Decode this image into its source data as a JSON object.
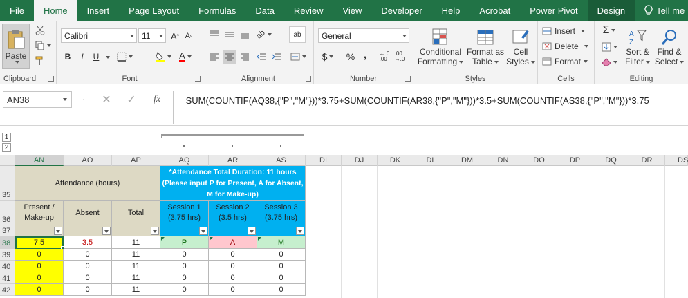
{
  "tabs": [
    "File",
    "Home",
    "Insert",
    "Page Layout",
    "Formulas",
    "Data",
    "Review",
    "View",
    "Developer",
    "Help",
    "Acrobat",
    "Power Pivot",
    "Design",
    "Tell me"
  ],
  "ribbon": {
    "clipboard": {
      "label": "Clipboard",
      "paste": "Paste"
    },
    "font": {
      "label": "Font",
      "name": "Calibri",
      "size": "11",
      "bold": "B",
      "italic": "I",
      "underline": "U"
    },
    "alignment": {
      "label": "Alignment"
    },
    "number": {
      "label": "Number",
      "format": "General",
      "currency": "$",
      "percent": "%",
      "comma": ","
    },
    "styles": {
      "label": "Styles",
      "cond1": "Conditional",
      "cond2": "Formatting",
      "fmt1": "Format as",
      "fmt2": "Table",
      "cell1": "Cell",
      "cell2": "Styles"
    },
    "cells": {
      "label": "Cells",
      "insert": "Insert",
      "delete": "Delete",
      "format": "Format"
    },
    "editing": {
      "label": "Editing",
      "sort1": "Sort &",
      "sort2": "Filter",
      "find1": "Find &",
      "find2": "Select"
    }
  },
  "formula_bar": {
    "name_box": "AN38",
    "fx": "fx",
    "formula": "=SUM(COUNTIF(AQ38,{\"P\",\"M\"}))*3.75+SUM(COUNTIF(AR38,{\"P\",\"M\"}))*3.5+SUM(COUNTIF(AS38,{\"P\",\"M\"}))*3.75"
  },
  "outline_levels": [
    "1",
    "2"
  ],
  "columns": [
    "AN",
    "AO",
    "AP",
    "AQ",
    "AR",
    "AS",
    "DI",
    "DJ",
    "DK",
    "DL",
    "DM",
    "DN",
    "DO",
    "DP",
    "DQ",
    "DR",
    "DS"
  ],
  "rows": [
    "35",
    "36",
    "37",
    "38",
    "39",
    "40",
    "41",
    "42"
  ],
  "sheet": {
    "attendance_header": "Attendance (hours)",
    "total_duration_line1": "*Attendance Total Duration: 11 hours",
    "total_duration_line2": "(Please input P for Present, A for Absent,",
    "total_duration_line3": "M for Make-up)",
    "present_l1": "Present /",
    "present_l2": "Make-up",
    "absent": "Absent",
    "total": "Total",
    "s1_l1": "Session 1",
    "s1_l2": "(3.75 hrs)",
    "s2_l1": "Session 2",
    "s2_l2": "(3.5 hrs)",
    "s3_l1": "Session 3",
    "s3_l2": "(3.75 hrs)",
    "data": [
      [
        "7.5",
        "3.5",
        "11",
        "P",
        "A",
        "M"
      ],
      [
        "0",
        "0",
        "11",
        "0",
        "0",
        "0"
      ],
      [
        "0",
        "0",
        "11",
        "0",
        "0",
        "0"
      ],
      [
        "0",
        "0",
        "11",
        "0",
        "0",
        "0"
      ],
      [
        "0",
        "0",
        "11",
        "0",
        "0",
        "0"
      ]
    ]
  },
  "colors": {
    "excel_green": "#217346",
    "header_tan": "#ddd9c4",
    "session_blue": "#00b0f0",
    "present_yellow": "#ffff00",
    "p_green": "#c6efce",
    "a_red": "#ffc7ce",
    "absent_red": "#c00000"
  }
}
